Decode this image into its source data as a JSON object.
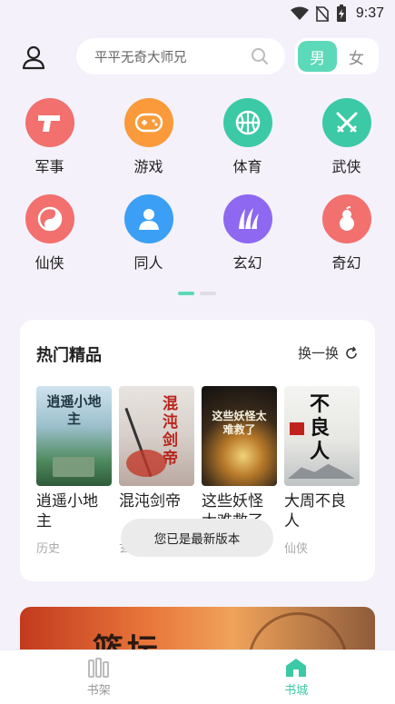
{
  "status_bar": {
    "time": "9:37"
  },
  "header": {
    "search_placeholder": "平平无奇大师兄",
    "gender": {
      "male": "男",
      "female": "女",
      "selected": "男"
    }
  },
  "categories": [
    {
      "label": "军事",
      "icon": "gun-icon",
      "color": "#f2706e"
    },
    {
      "label": "游戏",
      "icon": "gamepad-icon",
      "color": "#fa9a3a"
    },
    {
      "label": "体育",
      "icon": "basketball-icon",
      "color": "#3cc9a6"
    },
    {
      "label": "武侠",
      "icon": "crossed-swords-icon",
      "color": "#3cc9a6"
    },
    {
      "label": "仙侠",
      "icon": "yin-yang-icon",
      "color": "#f2706e"
    },
    {
      "label": "同人",
      "icon": "person-icon",
      "color": "#3a9ff5"
    },
    {
      "label": "玄幻",
      "icon": "claw-icon",
      "color": "#8e68f0"
    },
    {
      "label": "奇幻",
      "icon": "gourd-icon",
      "color": "#f2706e"
    }
  ],
  "featured": {
    "title": "热门精品",
    "refresh_label": "换一换",
    "books": [
      {
        "title": "逍遥小地主",
        "genre": "历史",
        "cover_text": "逍遥小地主"
      },
      {
        "title": "混沌剑帝",
        "genre": "玄",
        "cover_text": "混沌剑帝"
      },
      {
        "title": "这些妖怪太难救了",
        "genre": "",
        "cover_text": "这些妖怪太难救了"
      },
      {
        "title": "大周不良人",
        "genre": "仙侠",
        "cover_text": "不良人"
      }
    ]
  },
  "toast": "您已是最新版本",
  "banner": {
    "text": "篮坛"
  },
  "bottom_nav": {
    "bookshelf": "书架",
    "bookstore": "书城",
    "active": "书城"
  }
}
